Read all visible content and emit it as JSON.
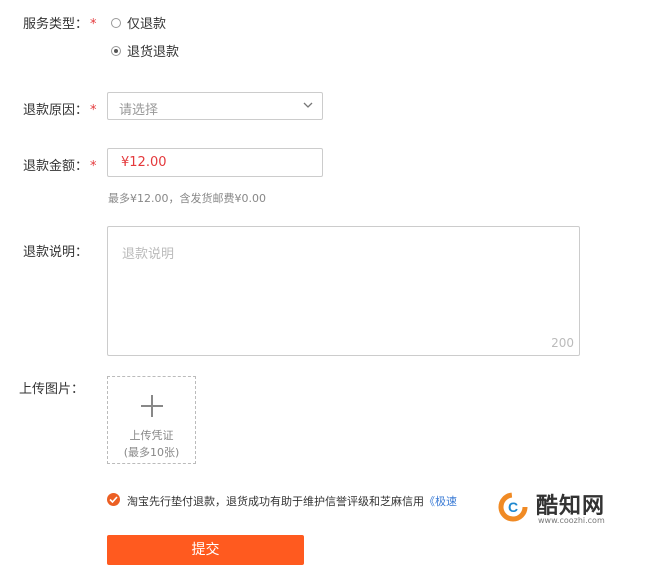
{
  "form": {
    "service_type_label": "服务类型：",
    "required_mark": "*",
    "service_options": [
      {
        "label": "仅退款",
        "checked": false
      },
      {
        "label": "退货退款",
        "checked": true
      }
    ],
    "reason_label": "退款原因：",
    "reason_placeholder": "请选择",
    "amount_label": "退款金额：",
    "amount_value": "¥12.00",
    "amount_hint": "最多¥12.00，含发货邮费¥0.00",
    "desc_label": "退款说明：",
    "desc_placeholder": "退款说明",
    "desc_counter": "200",
    "upload_label": "上传图片：",
    "upload_line1": "上传凭证",
    "upload_line2": "(最多10张)",
    "notice_text": "淘宝先行垫付退款，退货成功有助于维护信誉评级和芝麻信用",
    "notice_link": "《极速",
    "submit_label": "提交"
  },
  "watermark": {
    "name": "酷知网",
    "url": "www.coozhi.com"
  },
  "colors": {
    "accent": "#ff5a1f",
    "required": "#e4393c",
    "link": "#3a7bd5"
  }
}
